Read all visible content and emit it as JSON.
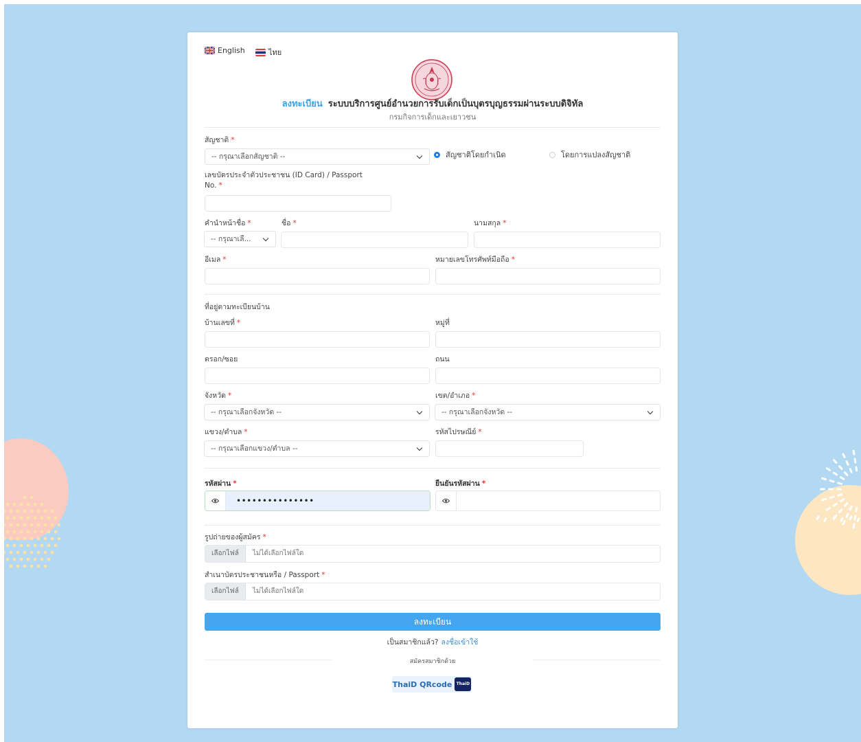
{
  "lang": {
    "english": "English",
    "thai": "ไทย"
  },
  "header": {
    "register_word": "ลงทะเบียน",
    "title": "ระบบบริการศูนย์อำนวยการรับเด็กเป็นบุตรบุญธรรมผ่านระบบดิจิทัล",
    "subtitle": "กรมกิจการเด็กและเยาวชน"
  },
  "form": {
    "nationality_label": "สัญชาติ",
    "nationality_select": "-- กรุณาเลือกสัญชาติ --",
    "radio_birth": "สัญชาติโดยกำเนิด",
    "radio_naturalized": "โดยการแปลงสัญชาติ",
    "idcard_label_line1": "เลขบัตรประจำตัวประชาชน (ID Card) / Passport",
    "idcard_label_line2": "No.",
    "prefix_label": "คำนำหน้าชื่อ",
    "prefix_select": "-- กรุณาเลื...",
    "firstname_label": "ชื่อ",
    "lastname_label": "นามสกุล",
    "email_label": "อีเมล",
    "mobile_label": "หมายเลขโทรศัพท์มือถือ",
    "address_section": "ที่อยู่ตามทะเบียนบ้าน",
    "house_no_label": "บ้านเลขที่",
    "moo_label": "หมู่ที่",
    "soi_label": "ตรอก/ซอย",
    "road_label": "ถนน",
    "province_label": "จังหวัด",
    "province_select": "-- กรุณาเลือกจังหวัด --",
    "district_label": "เขต/อำเภอ",
    "district_select": "-- กรุณาเลือกจังหวัด --",
    "subdistrict_label": "แขวง/ตำบล",
    "subdistrict_select": "-- กรุณาเลือกแขวง/ตำบล --",
    "postcode_label": "รหัสไปรษณีย์",
    "password_label": "รหัสผ่าน",
    "password_value": "•••••••••••••••",
    "confirm_password_label": "ยืนยันรหัสผ่าน",
    "photo_label": "รูปถ่ายของผู้สมัคร",
    "idcopy_label": "สำเนาบัตรประชาชนหรือ / Passport",
    "file_button": "เลือกไฟล์",
    "file_none": "ไม่ได้เลือกไฟล์ใด",
    "required_mark": "*"
  },
  "actions": {
    "submit": "ลงทะเบียน",
    "already_member": "เป็นสมาชิกแล้ว?",
    "login_link": "ลงชื่อเข้าใช้",
    "signup_with": "สมัครสมาชิกด้วย",
    "thaid": "ThaiD QRcode",
    "thaid_logo": "ThaiD"
  },
  "colors": {
    "background": "#b3d8f1",
    "accent": "#3aa2e6",
    "submit": "#45a5ee",
    "required": "#e3342f"
  }
}
